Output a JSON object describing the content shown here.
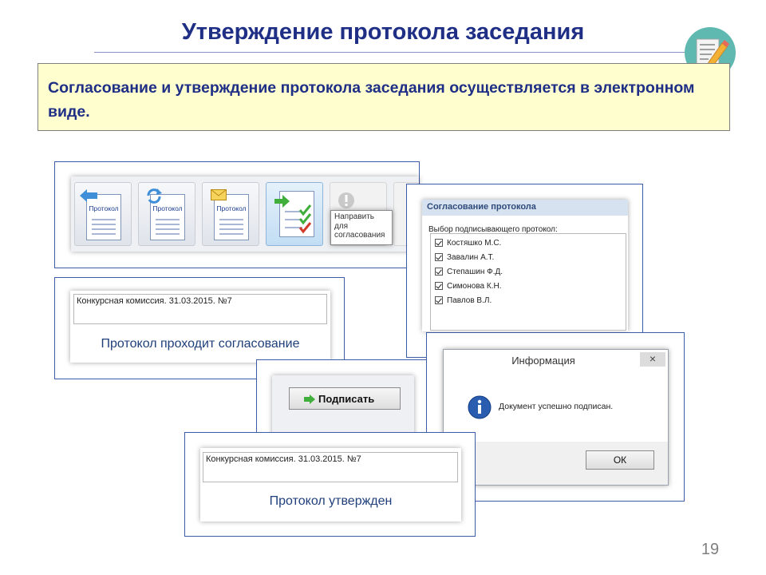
{
  "slide": {
    "title": "Утверждение протокола заседания",
    "callout": "Согласование и утверждение протокола заседания осуществляется в электронном виде.",
    "page_number": "19"
  },
  "toolbar": {
    "buttons": [
      {
        "icon": "document-back-icon",
        "label": "Протокол"
      },
      {
        "icon": "document-refresh-icon",
        "label": "Протокол"
      },
      {
        "icon": "document-mail-icon",
        "label": "Протокол"
      },
      {
        "icon": "document-approve-icon",
        "label": ""
      },
      {
        "icon": "info-disabled-icon",
        "label": ""
      }
    ],
    "tooltip": "Направить для согласования"
  },
  "status_card_1": {
    "field_value": "Конкурсная комиссия. 31.03.2015. №7",
    "status_text": "Протокол проходит согласование"
  },
  "approval_panel": {
    "header": "Согласование протокола",
    "subtitle": "Выбор подписывающего протокол:",
    "signers": [
      "Костяшко М.С.",
      "Завалин А.Т.",
      "Степашин Ф.Д.",
      "Симонова К.Н.",
      "Павлов В.Л."
    ]
  },
  "sign_panel": {
    "button_label": "Подписать"
  },
  "info_dialog": {
    "title": "Информация",
    "close_label": "×",
    "message": "Документ успешно подписан.",
    "ok_label": "ОК"
  },
  "status_card_2": {
    "field_value": "Конкурсная комиссия. 31.03.2015. №7",
    "status_text": "Протокол утвержден"
  },
  "colors": {
    "title": "#1f2f86",
    "callout_bg": "#fefece",
    "frame_border": "#3e5ba8",
    "badge": "#5fb9b0",
    "info_icon": "#2a5db0"
  }
}
